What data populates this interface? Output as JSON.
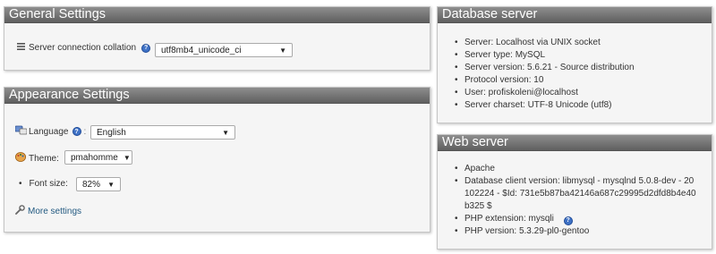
{
  "general": {
    "title": "General Settings",
    "collation_label": "Server connection collation",
    "collation_value": "utf8mb4_unicode_ci"
  },
  "appearance": {
    "title": "Appearance Settings",
    "language_label": "Language",
    "language_value": "English",
    "theme_label": "Theme:",
    "theme_value": "pmahomme",
    "fontsize_label": "Font size:",
    "fontsize_value": "82%",
    "more_settings": "More settings"
  },
  "database_server": {
    "title": "Database server",
    "items": [
      "Server: Localhost via UNIX socket",
      "Server type: MySQL",
      "Server version: 5.6.21 - Source distribution",
      "Protocol version: 10",
      "User: profiskoleni@localhost",
      "Server charset: UTF-8 Unicode (utf8)"
    ]
  },
  "web_server": {
    "title": "Web server",
    "items": [
      "Apache",
      "Database client version: libmysql - mysqlnd 5.0.8-dev - 20102224 - $Id: 731e5b87ba42146a687c29995d2dfd8b4e40b325 $",
      "PHP extension: mysqli",
      "PHP version: 5.3.29-pl0-gentoo"
    ]
  },
  "icons": {
    "help": "help-icon",
    "collation": "list-icon",
    "language": "language-icon",
    "theme": "theme-palette-icon",
    "more": "wrench-icon"
  }
}
